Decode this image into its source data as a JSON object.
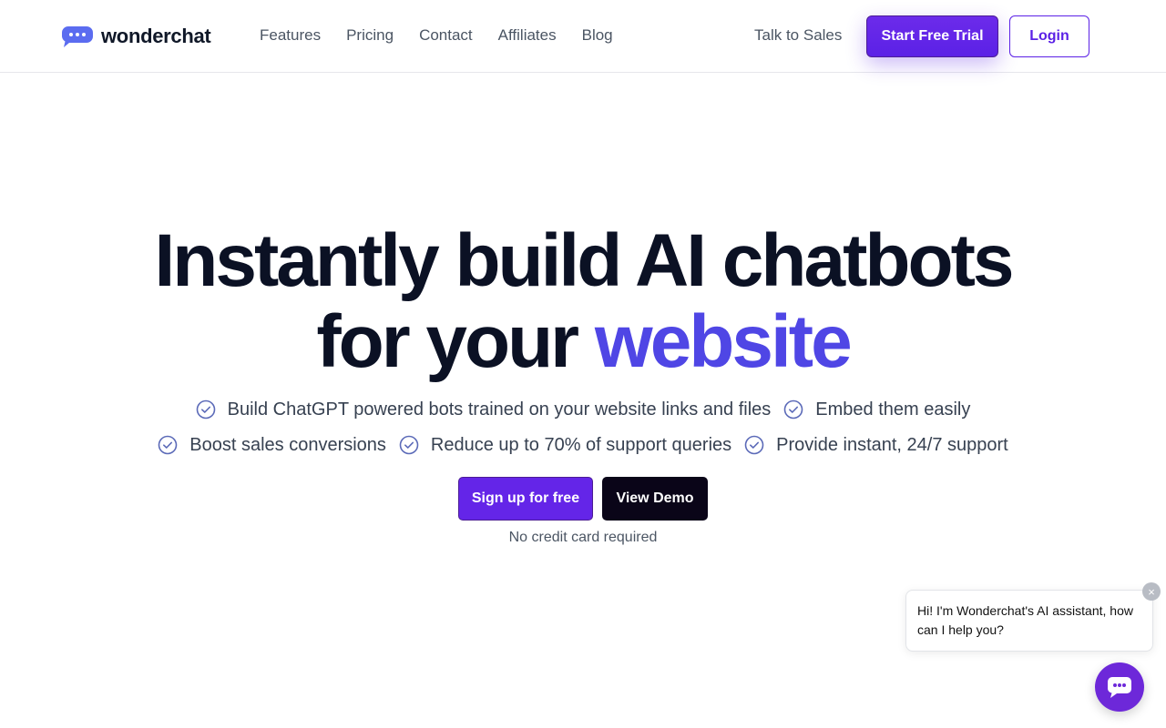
{
  "brand": {
    "name": "wonderchat",
    "logo_icon": "chat-bubble-dots-icon",
    "accent_color": "#5b21e6"
  },
  "nav": {
    "items": [
      {
        "label": "Features"
      },
      {
        "label": "Pricing"
      },
      {
        "label": "Contact"
      },
      {
        "label": "Affiliates"
      },
      {
        "label": "Blog"
      }
    ],
    "talk_to_sales": "Talk to Sales",
    "start_trial": "Start Free Trial",
    "login": "Login"
  },
  "hero": {
    "headline_line1": "Instantly build AI chatbots",
    "headline_line2_prefix": "for your",
    "headline_line2_accent": "website",
    "features_row1": [
      {
        "text": "Build ChatGPT powered bots trained on your website links and files",
        "icon": "check-circle-icon"
      },
      {
        "text": "Embed them easily",
        "icon": "check-circle-icon"
      }
    ],
    "features_row2": [
      {
        "text": "Boost sales conversions",
        "icon": "check-circle-icon"
      },
      {
        "text": "Reduce up to 70% of support queries",
        "icon": "check-circle-icon"
      },
      {
        "text": "Provide instant, 24/7 support",
        "icon": "check-circle-icon"
      }
    ],
    "signup_label": "Sign up for free",
    "demo_label": "View Demo",
    "no_card": "No credit card required"
  },
  "chat_widget": {
    "greeting": "Hi! I'm Wonderchat's AI assistant, how can I help you?",
    "close_glyph": "×",
    "close_icon": "close-icon",
    "launcher_icon": "chat-icon"
  }
}
